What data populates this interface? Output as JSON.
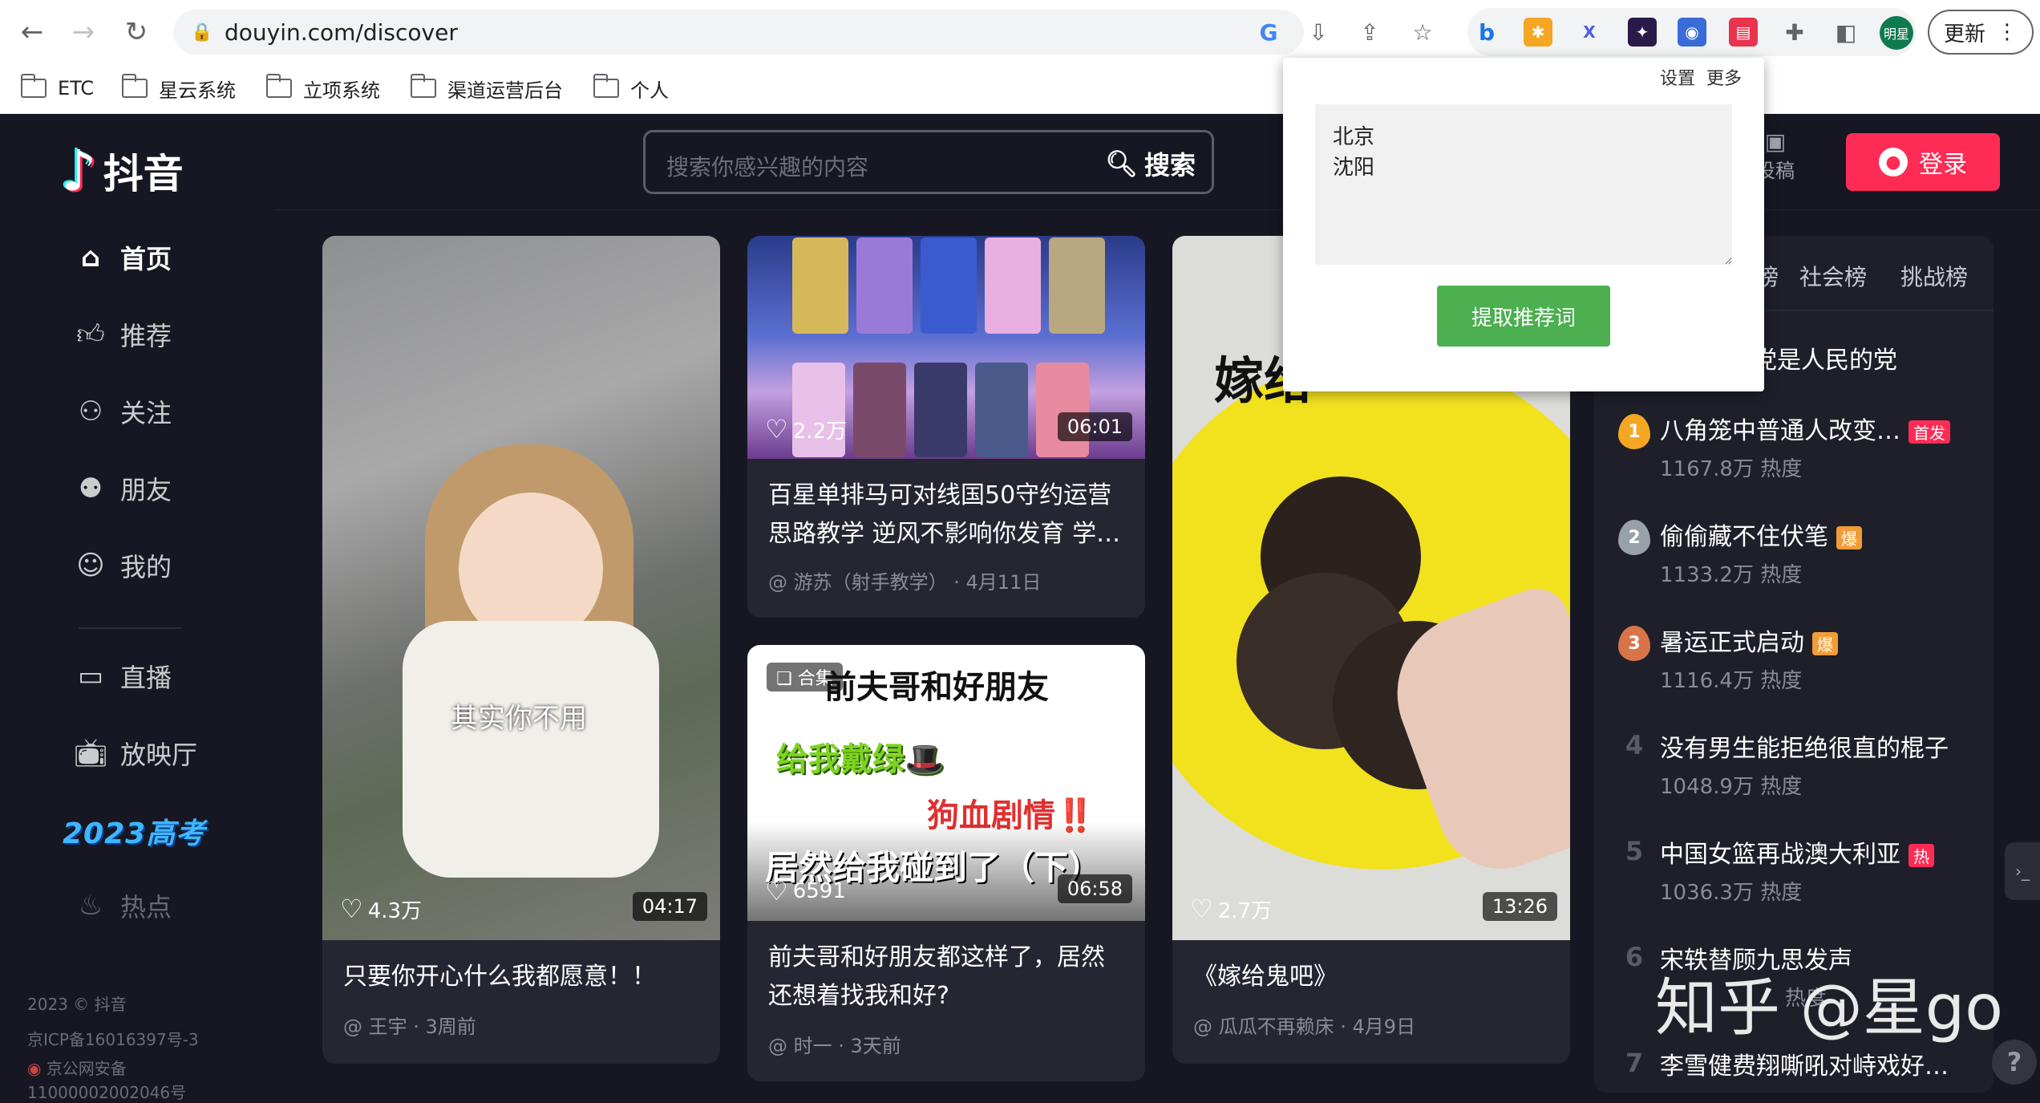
{
  "browser": {
    "url": "douyin.com/discover",
    "update_label": "更新",
    "profile_label": "明星",
    "bookmarks": [
      "ETC",
      "星云系统",
      "立项系统",
      "渠道运营后台",
      "个人"
    ]
  },
  "sidebar": {
    "logo_text": "抖音",
    "items": [
      {
        "label": "首页",
        "icon": "home-icon"
      },
      {
        "label": "推荐",
        "icon": "thumbs-up-icon"
      },
      {
        "label": "关注",
        "icon": "user-plus-icon"
      },
      {
        "label": "朋友",
        "icon": "friends-icon"
      },
      {
        "label": "我的",
        "icon": "user-icon"
      },
      {
        "label": "直播",
        "icon": "live-icon"
      },
      {
        "label": "放映厅",
        "icon": "tv-icon"
      },
      {
        "label": "热点",
        "icon": "flame-icon"
      }
    ],
    "gaokao_badge": "2023高考",
    "footer": [
      "2023 © 抖音",
      "京ICP备16016397号-3",
      "京公网安备",
      "11000002002046号"
    ]
  },
  "header": {
    "search_placeholder": "搜索你感兴趣的内容",
    "search_button": "搜索",
    "upload_label": "投稿",
    "login_label": "登录"
  },
  "videos": [
    {
      "title": "只要你开心什么我都愿意！！",
      "author": "@ 王宇",
      "time": "· 3周前",
      "likes": "4.3万",
      "duration": "04:17",
      "overlay": "其实你不用"
    },
    {
      "title_line1": "百星单排马可对线国50守约运营",
      "title_line2": "思路教学 逆风不影响你发育 学…",
      "author": "@ 游苏（射手教学）",
      "time": "· 4月11日",
      "likes": "2.2万",
      "duration": "06:01"
    },
    {
      "title_line1": "前夫哥和好朋友都这样了，居然",
      "title_line2": "还想着找我和好?",
      "author": "@ 时一",
      "time": "· 3天前",
      "likes": "6591",
      "duration": "06:58",
      "collection": "合集",
      "overlay1": "前夫哥和好朋友",
      "overlay2": "给我戴绿🎩",
      "overlay3": "狗血剧情‼️",
      "overlay4": "居然给我碰到了（下）"
    },
    {
      "title": "《嫁给鬼吧》",
      "author": "@ 瓜瓜不再赖床",
      "time": "· 4月9日",
      "likes": "2.7万",
      "duration": "13:26",
      "overlay": "嫁给"
    }
  ],
  "ranking": {
    "tabs": [
      "榜",
      "社会榜",
      "挑战榜"
    ],
    "partial_top": "党是人民的党",
    "items": [
      {
        "rank": "1",
        "title": "八角笼中普通人改变…",
        "heat": "1167.8万 热度",
        "badge": "首发",
        "badge_color": "#fe2c55"
      },
      {
        "rank": "2",
        "title": "偷偷藏不住伏笔",
        "heat": "1133.2万 热度",
        "badge": "爆",
        "badge_color": "#f29c38"
      },
      {
        "rank": "3",
        "title": "暑运正式启动",
        "heat": "1116.4万 热度",
        "badge": "爆",
        "badge_color": "#f29c38"
      },
      {
        "rank": "4",
        "title": "没有男生能拒绝很直的棍子",
        "heat": "1048.9万 热度",
        "badge": "",
        "badge_color": ""
      },
      {
        "rank": "5",
        "title": "中国女篮再战澳大利亚",
        "heat": "1036.3万 热度",
        "badge": "热",
        "badge_color": "#fe2c55"
      },
      {
        "rank": "6",
        "title": "宋轶替顾九思发声",
        "heat": "热度",
        "badge": "",
        "badge_color": ""
      },
      {
        "rank": "7",
        "title": "李雪健费翔嘶吼对峙戏好…",
        "heat": "",
        "badge": "",
        "badge_color": ""
      }
    ]
  },
  "popup": {
    "settings_link": "设置",
    "more_link": "更多",
    "textarea_value": "北京\n沈阳",
    "fetch_button": "提取推荐词"
  },
  "watermark": "知乎 @星go",
  "colors": {
    "accent": "#fe2c55",
    "bg": "#161722",
    "card": "#252632",
    "popup_button": "#4caf50"
  }
}
